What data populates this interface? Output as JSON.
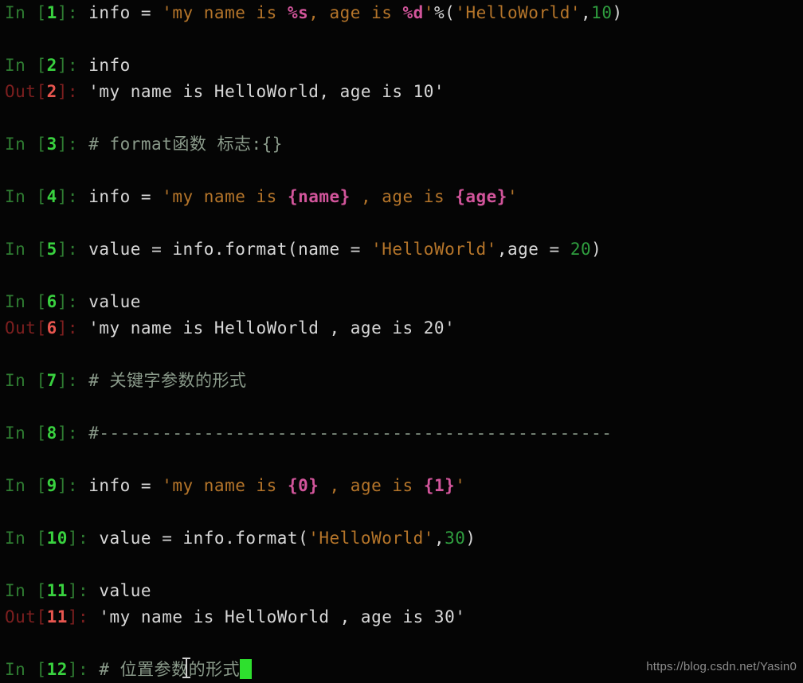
{
  "terminal": {
    "app": "IPython console",
    "background_color": "#050505",
    "prompt_in_label": "In ",
    "prompt_out_label": "Out",
    "colors": {
      "in_prompt": "#2f7d32",
      "in_number": "#39d13f",
      "out_prompt": "#7d1f1f",
      "out_number": "#e8564f",
      "string": "#b5752a",
      "format_spec": "#d2559b",
      "number": "#2f9e3f",
      "plain": "#d8d8d8",
      "comment": "#8a9a8a",
      "cursor": "#2ee02e"
    },
    "cells": [
      {
        "kind": "in",
        "number": "1",
        "tokens": [
          {
            "t": "info ",
            "c": "plain"
          },
          {
            "t": "= ",
            "c": "op"
          },
          {
            "t": "'my name is ",
            "c": "str"
          },
          {
            "t": "%s",
            "c": "fmt"
          },
          {
            "t": ", age is ",
            "c": "str"
          },
          {
            "t": "%d",
            "c": "fmt"
          },
          {
            "t": "'",
            "c": "str"
          },
          {
            "t": "%",
            "c": "op"
          },
          {
            "t": "(",
            "c": "plain"
          },
          {
            "t": "'HelloWorld'",
            "c": "str"
          },
          {
            "t": ",",
            "c": "plain"
          },
          {
            "t": "10",
            "c": "num"
          },
          {
            "t": ")",
            "c": "plain"
          }
        ],
        "plain": "info = 'my name is %s, age is %d'%('HelloWorld',10)"
      },
      {
        "kind": "in",
        "number": "2",
        "tokens": [
          {
            "t": "info",
            "c": "plain"
          }
        ],
        "plain": "info"
      },
      {
        "kind": "out",
        "number": "2",
        "tokens": [
          {
            "t": "'my name is HelloWorld, age is 10'",
            "c": "out"
          }
        ],
        "plain": "'my name is HelloWorld, age is 10'"
      },
      {
        "kind": "in",
        "number": "3",
        "tokens": [
          {
            "t": "# format函数 标志:{}",
            "c": "comment"
          }
        ],
        "plain": "# format函数 标志:{}"
      },
      {
        "kind": "in",
        "number": "4",
        "tokens": [
          {
            "t": "info ",
            "c": "plain"
          },
          {
            "t": "= ",
            "c": "op"
          },
          {
            "t": "'my name is ",
            "c": "str"
          },
          {
            "t": "{name}",
            "c": "fmt"
          },
          {
            "t": " , age is ",
            "c": "str"
          },
          {
            "t": "{age}",
            "c": "fmt"
          },
          {
            "t": "'",
            "c": "str"
          }
        ],
        "plain": "info = 'my name is {name} , age is {age}'"
      },
      {
        "kind": "in",
        "number": "5",
        "tokens": [
          {
            "t": "value ",
            "c": "plain"
          },
          {
            "t": "= ",
            "c": "op"
          },
          {
            "t": "info.format(name ",
            "c": "plain"
          },
          {
            "t": "= ",
            "c": "op"
          },
          {
            "t": "'HelloWorld'",
            "c": "str"
          },
          {
            "t": ",age ",
            "c": "plain"
          },
          {
            "t": "= ",
            "c": "op"
          },
          {
            "t": "20",
            "c": "num"
          },
          {
            "t": ")",
            "c": "plain"
          }
        ],
        "plain": "value = info.format(name = 'HelloWorld',age = 20)"
      },
      {
        "kind": "in",
        "number": "6",
        "tokens": [
          {
            "t": "value",
            "c": "plain"
          }
        ],
        "plain": "value"
      },
      {
        "kind": "out",
        "number": "6",
        "tokens": [
          {
            "t": "'my name is HelloWorld , age is 20'",
            "c": "out"
          }
        ],
        "plain": "'my name is HelloWorld , age is 20'"
      },
      {
        "kind": "in",
        "number": "7",
        "tokens": [
          {
            "t": "# 关键字参数的形式",
            "c": "comment"
          }
        ],
        "plain": "# 关键字参数的形式"
      },
      {
        "kind": "in",
        "number": "8",
        "tokens": [
          {
            "t": "#-------------------------------------------------",
            "c": "comment"
          }
        ],
        "plain": "#-------------------------------------------------"
      },
      {
        "kind": "in",
        "number": "9",
        "tokens": [
          {
            "t": "info ",
            "c": "plain"
          },
          {
            "t": "= ",
            "c": "op"
          },
          {
            "t": "'my name is ",
            "c": "str"
          },
          {
            "t": "{0}",
            "c": "fmt"
          },
          {
            "t": " , age is ",
            "c": "str"
          },
          {
            "t": "{1}",
            "c": "fmt"
          },
          {
            "t": "'",
            "c": "str"
          }
        ],
        "plain": "info = 'my name is {0} , age is {1}'"
      },
      {
        "kind": "in",
        "number": "10",
        "tokens": [
          {
            "t": "value ",
            "c": "plain"
          },
          {
            "t": "= ",
            "c": "op"
          },
          {
            "t": "info.format(",
            "c": "plain"
          },
          {
            "t": "'HelloWorld'",
            "c": "str"
          },
          {
            "t": ",",
            "c": "plain"
          },
          {
            "t": "30",
            "c": "num"
          },
          {
            "t": ")",
            "c": "plain"
          }
        ],
        "plain": "value = info.format('HelloWorld',30)"
      },
      {
        "kind": "in",
        "number": "11",
        "tokens": [
          {
            "t": "value",
            "c": "plain"
          }
        ],
        "plain": "value"
      },
      {
        "kind": "out",
        "number": "11",
        "tokens": [
          {
            "t": "'my name is HelloWorld , age is 30'",
            "c": "out"
          }
        ],
        "plain": "'my name is HelloWorld , age is 30'"
      },
      {
        "kind": "in",
        "number": "12",
        "cursor": true,
        "tokens": [
          {
            "t": "# 位置参数的形式",
            "c": "comment"
          }
        ],
        "plain": "# 位置参数的形式"
      }
    ]
  },
  "watermark": {
    "text": "https://blog.csdn.net/Yasin0"
  }
}
